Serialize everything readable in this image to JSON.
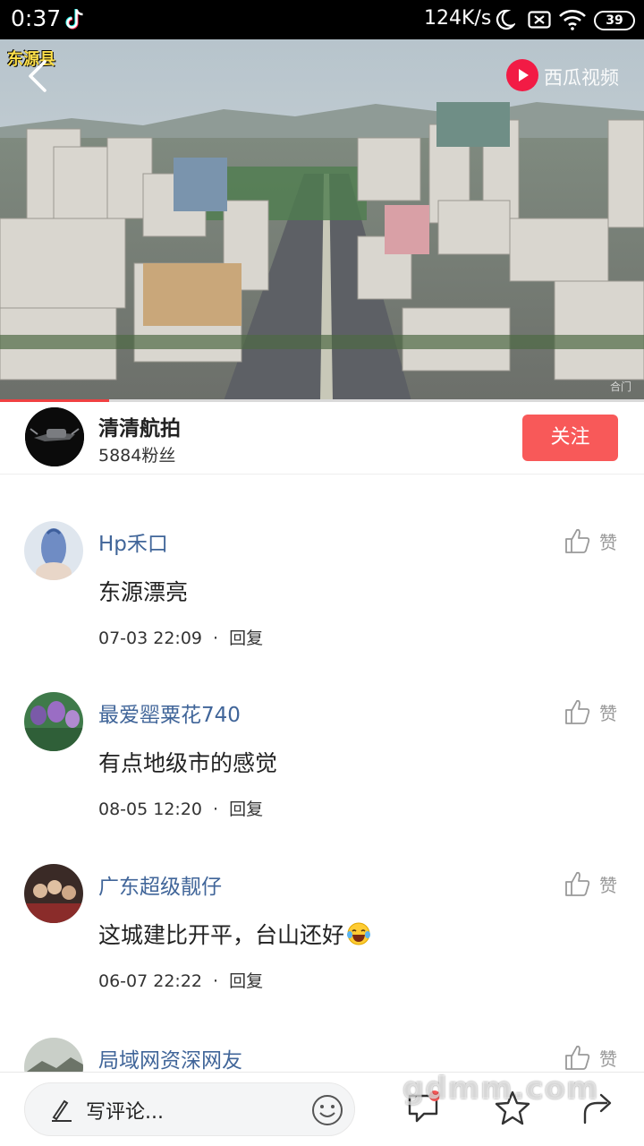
{
  "status_bar": {
    "time": "0:37",
    "network_speed": "124K/s",
    "battery_level": "39",
    "icons": [
      "tiktok-icon",
      "moon-icon",
      "sim-icon",
      "wifi-icon",
      "battery-icon"
    ]
  },
  "video": {
    "watermark_left": "东源县",
    "brand_name": "西瓜视频",
    "corner_tag": "合门",
    "progress_percent": 17
  },
  "author": {
    "name": "清清航拍",
    "fans": "5884粉丝",
    "follow_label": "关注"
  },
  "comments": [
    {
      "user": "Hp禾口",
      "text": "东源漂亮",
      "time": "07-03 22:09",
      "reply_label": "回复",
      "like_label": "赞"
    },
    {
      "user": "最爱罂粟花740",
      "text": "有点地级市的感觉",
      "time": "08-05 12:20",
      "reply_label": "回复",
      "like_label": "赞"
    },
    {
      "user": "广东超级靓仔",
      "text": "这城建比开平，台山还好",
      "emoji": "laughing-tears-emoji",
      "time": "06-07 22:22",
      "reply_label": "回复",
      "like_label": "赞"
    },
    {
      "user": "局域网资深网友",
      "like_label": "赞"
    }
  ],
  "bottom_bar": {
    "input_placeholder": "写评论...",
    "icons": [
      "comment-icon",
      "favorite-star-icon",
      "share-icon"
    ]
  },
  "site_watermark": "gdmm.com",
  "colors": {
    "accent": "#f85959",
    "username": "#406599",
    "progress": "#f04142"
  }
}
